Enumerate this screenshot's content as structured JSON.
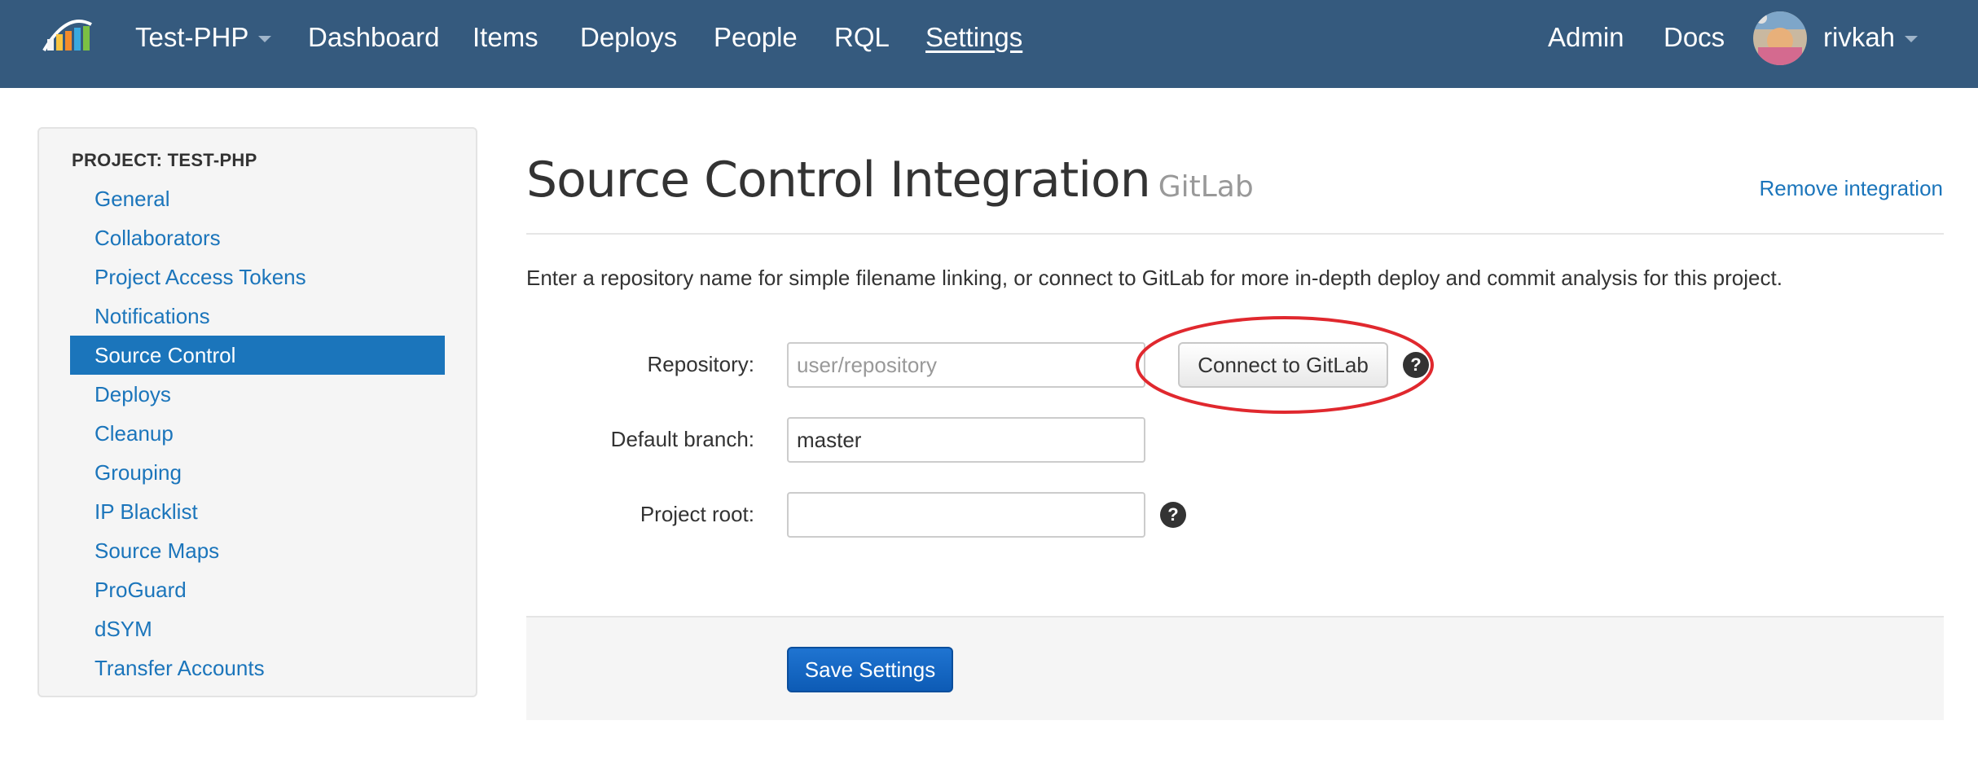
{
  "topnav": {
    "project": "Test-PHP",
    "items": [
      "Dashboard",
      "Items",
      "Deploys",
      "People",
      "RQL",
      "Settings"
    ],
    "right_items": [
      "Admin",
      "Docs"
    ],
    "username": "rivkah",
    "logo_icon": "rollbar-bars-logo",
    "background": "#355a7e"
  },
  "sidebar": {
    "header": "PROJECT: TEST-PHP",
    "items": [
      "General",
      "Collaborators",
      "Project Access Tokens",
      "Notifications",
      "Source Control",
      "Deploys",
      "Cleanup",
      "Grouping",
      "IP Blacklist",
      "Source Maps",
      "ProGuard",
      "dSYM",
      "Transfer Accounts"
    ],
    "active": "Source Control"
  },
  "main": {
    "title": "Source Control Integration",
    "subtitle": "GitLab",
    "remove_link": "Remove integration",
    "description": "Enter a repository name for simple filename linking, or connect to GitLab for more in-depth deploy and commit analysis for this project.",
    "repository_label": "Repository:",
    "repository_placeholder": "user/repository",
    "repository_value": "",
    "connect_button": "Connect to GitLab",
    "branch_label": "Default branch:",
    "branch_value": "master",
    "root_label": "Project root:",
    "root_value": "",
    "help_glyph": "?",
    "save_button": "Save Settings"
  },
  "colors": {
    "link": "#1b75bb",
    "active_sidebar": "#1b75bb",
    "annotation_circle": "#e0282e",
    "save_button": "#1565c0"
  }
}
